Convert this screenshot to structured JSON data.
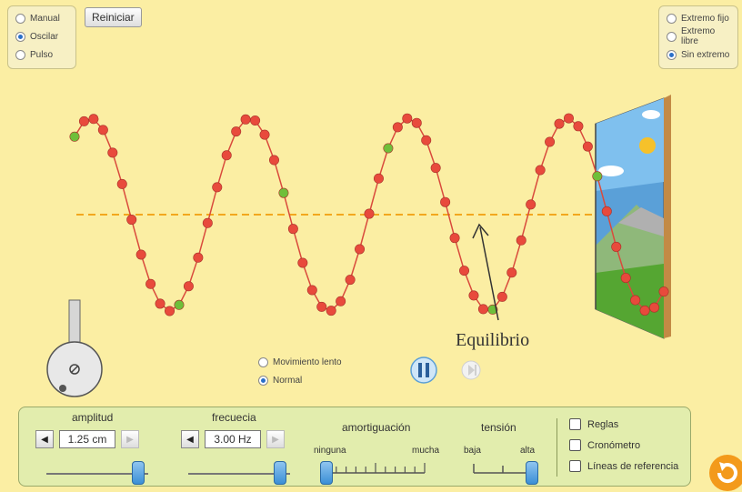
{
  "mode_options": [
    {
      "label": "Manual",
      "selected": false
    },
    {
      "label": "Oscilar",
      "selected": true
    },
    {
      "label": "Pulso",
      "selected": false
    }
  ],
  "reset_label": "Reiniciar",
  "end_options": [
    {
      "label": "Extremo fijo",
      "selected": false
    },
    {
      "label": "Extremo libre",
      "selected": false
    },
    {
      "label": "Sin extremo",
      "selected": true
    }
  ],
  "annotation": "Equilibrio",
  "speed_options": [
    {
      "label": "Movimiento lento",
      "selected": false
    },
    {
      "label": "Normal",
      "selected": true
    }
  ],
  "controls": {
    "amplitude": {
      "label": "amplitud",
      "value": "1.25 cm",
      "level": 0.95
    },
    "frequency": {
      "label": "frecuecia",
      "value": "3.00 Hz",
      "level": 0.95
    },
    "damping": {
      "label": "amortiguación",
      "min": "ninguna",
      "max": "mucha",
      "level": 0.0
    },
    "tension": {
      "label": "tensión",
      "min": "baja",
      "max": "alta",
      "level": 1.0
    }
  },
  "checkboxes": [
    {
      "label": "Reglas",
      "checked": false
    },
    {
      "label": "Cronómetro",
      "checked": false
    },
    {
      "label": "Líneas de referencia",
      "checked": false
    }
  ],
  "colors": {
    "background": "#fbeea3",
    "bead": "#e84a3c",
    "bead_marker": "#6fbf3a",
    "string": "#d94a3c",
    "equilibrium_line": "#f2a71e",
    "accent": "#3b8fd6",
    "reset_orange": "#f39a1b"
  },
  "icons": {
    "pause": "pause-icon",
    "step": "step-forward-icon",
    "reset_all": "reset-all-icon"
  }
}
